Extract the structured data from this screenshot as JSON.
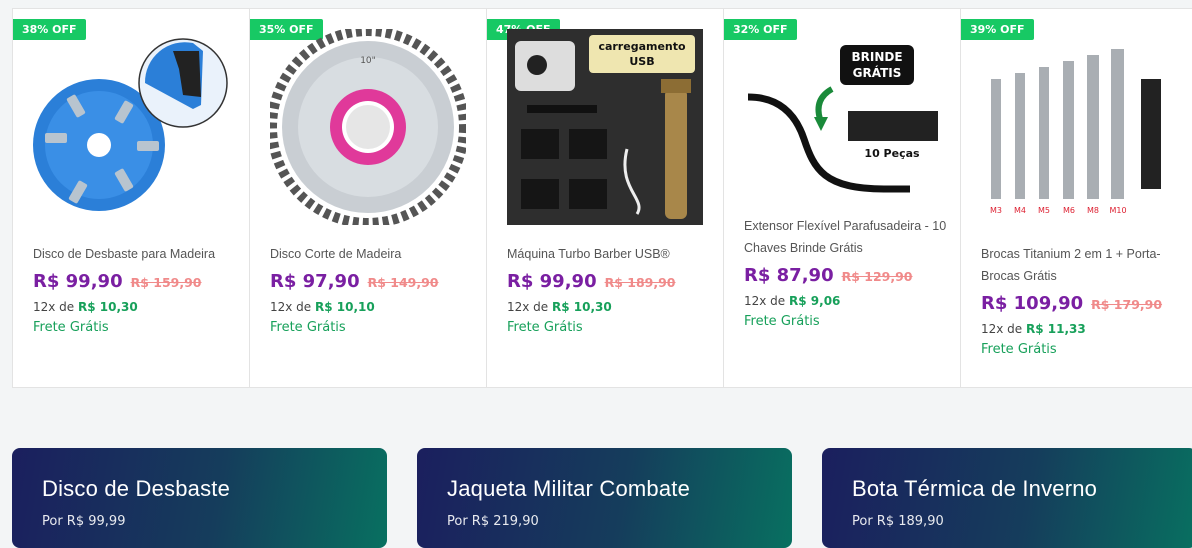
{
  "products": [
    {
      "badge": "38% OFF",
      "title": "Disco de Desbaste para Madeira",
      "price": "R$ 99,90",
      "old_price": "R$ 159,90",
      "installment_prefix": "12x de",
      "installment_value": "R$ 10,30",
      "shipping": "Frete Grátis",
      "icon": "wood-carving-disc-image"
    },
    {
      "badge": "35% OFF",
      "title": "Disco Corte de Madeira",
      "price": "R$ 97,90",
      "old_price": "R$ 149,90",
      "installment_prefix": "12x de",
      "installment_value": "R$ 10,10",
      "shipping": "Frete Grátis",
      "icon": "chainsaw-disc-image"
    },
    {
      "badge": "47% OFF",
      "title": "Máquina Turbo Barber USB®",
      "price": "R$ 99,90",
      "old_price": "R$ 189,90",
      "installment_prefix": "12x de",
      "installment_value": "R$ 10,30",
      "shipping": "Frete Grátis",
      "icon": "barber-machine-image",
      "image_label_line1": "carregamento",
      "image_label_line2": "USB"
    },
    {
      "badge": "32% OFF",
      "title": "Extensor Flexível Parafusadeira - 10 Chaves Brinde Grátis",
      "price": "R$ 87,90",
      "old_price": "R$ 129,90",
      "installment_prefix": "12x de",
      "installment_value": "R$ 9,06",
      "shipping": "Frete Grátis",
      "icon": "flexible-extension-image",
      "image_label_line1": "BRINDE",
      "image_label_line2": "GRÁTIS",
      "image_label_line3": "10 Peças"
    },
    {
      "badge": "39% OFF",
      "title": "Brocas Titanium 2 em 1 + Porta-Brocas Grátis",
      "price": "R$ 109,90",
      "old_price": "R$ 179,90",
      "installment_prefix": "12x de",
      "installment_value": "R$ 11,33",
      "shipping": "Frete Grátis",
      "icon": "drill-bits-image",
      "bit_labels": [
        "M3",
        "M4",
        "M5",
        "M6",
        "M8",
        "M10"
      ]
    }
  ],
  "banners": [
    {
      "title": "Disco de Desbaste",
      "price_line": "Por R$ 99,99"
    },
    {
      "title": "Jaqueta Militar Combate",
      "price_line": "Por R$ 219,90"
    },
    {
      "title": "Bota Térmica de Inverno",
      "price_line": "Por R$ 189,90"
    }
  ],
  "colors": {
    "badge": "#17c964",
    "price": "#7a1fa2",
    "old_price": "#f08a8a",
    "green": "#17a05a"
  }
}
